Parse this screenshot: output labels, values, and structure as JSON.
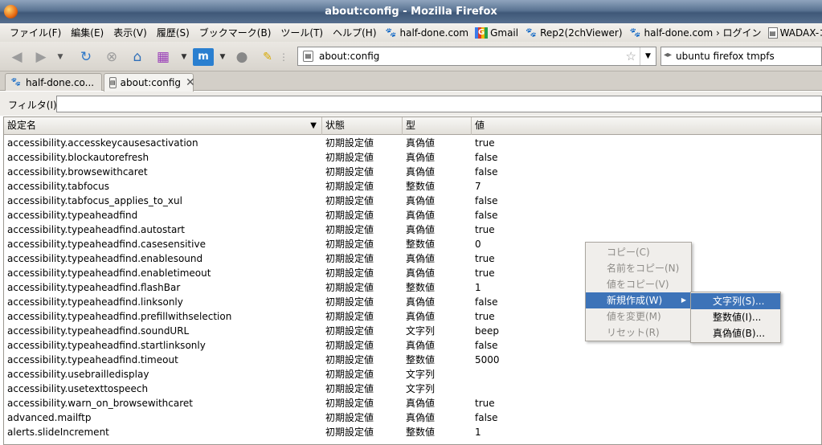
{
  "window": {
    "title": "about:config - Mozilla Firefox"
  },
  "menubar": {
    "menus": [
      "ファイル(F)",
      "編集(E)",
      "表示(V)",
      "履歴(S)",
      "ブックマーク(B)",
      "ツール(T)",
      "ヘルプ(H)"
    ],
    "bookmarks": [
      {
        "label": "half-done.com",
        "icon": "half-done-icon"
      },
      {
        "label": "Gmail",
        "icon": "gmail-icon"
      },
      {
        "label": "Rep2(2chViewer)",
        "icon": "half-done-icon"
      },
      {
        "label": "half-done.com › ログイン",
        "icon": "half-done-icon"
      },
      {
        "label": "WADAX-コントロール",
        "icon": "page-icon"
      }
    ]
  },
  "navbar": {
    "url": "about:config",
    "search": "ubuntu firefox tmpfs"
  },
  "tabs": [
    {
      "label": "half-done.co...",
      "icon": "half-done-icon",
      "active": false
    },
    {
      "label": "about:config",
      "icon": "page-icon",
      "active": true
    }
  ],
  "filter": {
    "label": "フィルタ(I):",
    "value": ""
  },
  "table": {
    "columns": [
      "設定名",
      "状態",
      "型",
      "値"
    ],
    "rows": [
      [
        "accessibility.accesskeycausesactivation",
        "初期設定値",
        "真偽値",
        "true"
      ],
      [
        "accessibility.blockautorefresh",
        "初期設定値",
        "真偽値",
        "false"
      ],
      [
        "accessibility.browsewithcaret",
        "初期設定値",
        "真偽値",
        "false"
      ],
      [
        "accessibility.tabfocus",
        "初期設定値",
        "整数値",
        "7"
      ],
      [
        "accessibility.tabfocus_applies_to_xul",
        "初期設定値",
        "真偽値",
        "false"
      ],
      [
        "accessibility.typeaheadfind",
        "初期設定値",
        "真偽値",
        "false"
      ],
      [
        "accessibility.typeaheadfind.autostart",
        "初期設定値",
        "真偽値",
        "true"
      ],
      [
        "accessibility.typeaheadfind.casesensitive",
        "初期設定値",
        "整数値",
        "0"
      ],
      [
        "accessibility.typeaheadfind.enablesound",
        "初期設定値",
        "真偽値",
        "true"
      ],
      [
        "accessibility.typeaheadfind.enabletimeout",
        "初期設定値",
        "真偽値",
        "true"
      ],
      [
        "accessibility.typeaheadfind.flashBar",
        "初期設定値",
        "整数値",
        "1"
      ],
      [
        "accessibility.typeaheadfind.linksonly",
        "初期設定値",
        "真偽値",
        "false"
      ],
      [
        "accessibility.typeaheadfind.prefillwithselection",
        "初期設定値",
        "真偽値",
        "true"
      ],
      [
        "accessibility.typeaheadfind.soundURL",
        "初期設定値",
        "文字列",
        "beep"
      ],
      [
        "accessibility.typeaheadfind.startlinksonly",
        "初期設定値",
        "真偽値",
        "false"
      ],
      [
        "accessibility.typeaheadfind.timeout",
        "初期設定値",
        "整数値",
        "5000"
      ],
      [
        "accessibility.usebrailledisplay",
        "初期設定値",
        "文字列",
        ""
      ],
      [
        "accessibility.usetexttospeech",
        "初期設定値",
        "文字列",
        ""
      ],
      [
        "accessibility.warn_on_browsewithcaret",
        "初期設定値",
        "真偽値",
        "true"
      ],
      [
        "advanced.mailftp",
        "初期設定値",
        "真偽値",
        "false"
      ],
      [
        "alerts.slideIncrement",
        "初期設定値",
        "整数値",
        "1"
      ]
    ]
  },
  "context_menu": {
    "items": [
      {
        "label": "コピー(C)",
        "enabled": false
      },
      {
        "label": "名前をコピー(N)",
        "enabled": false
      },
      {
        "label": "値をコピー(V)",
        "enabled": false
      },
      {
        "label": "新規作成(W)",
        "enabled": true,
        "submenu": true
      },
      {
        "label": "値を変更(M)",
        "enabled": false
      },
      {
        "label": "リセット(R)",
        "enabled": false
      }
    ],
    "submenu": [
      "文字列(S)...",
      "整数値(I)...",
      "真偽値(B)..."
    ]
  },
  "colors": {
    "highlight": "#3d73b8",
    "titlebar": "#4f6888"
  }
}
